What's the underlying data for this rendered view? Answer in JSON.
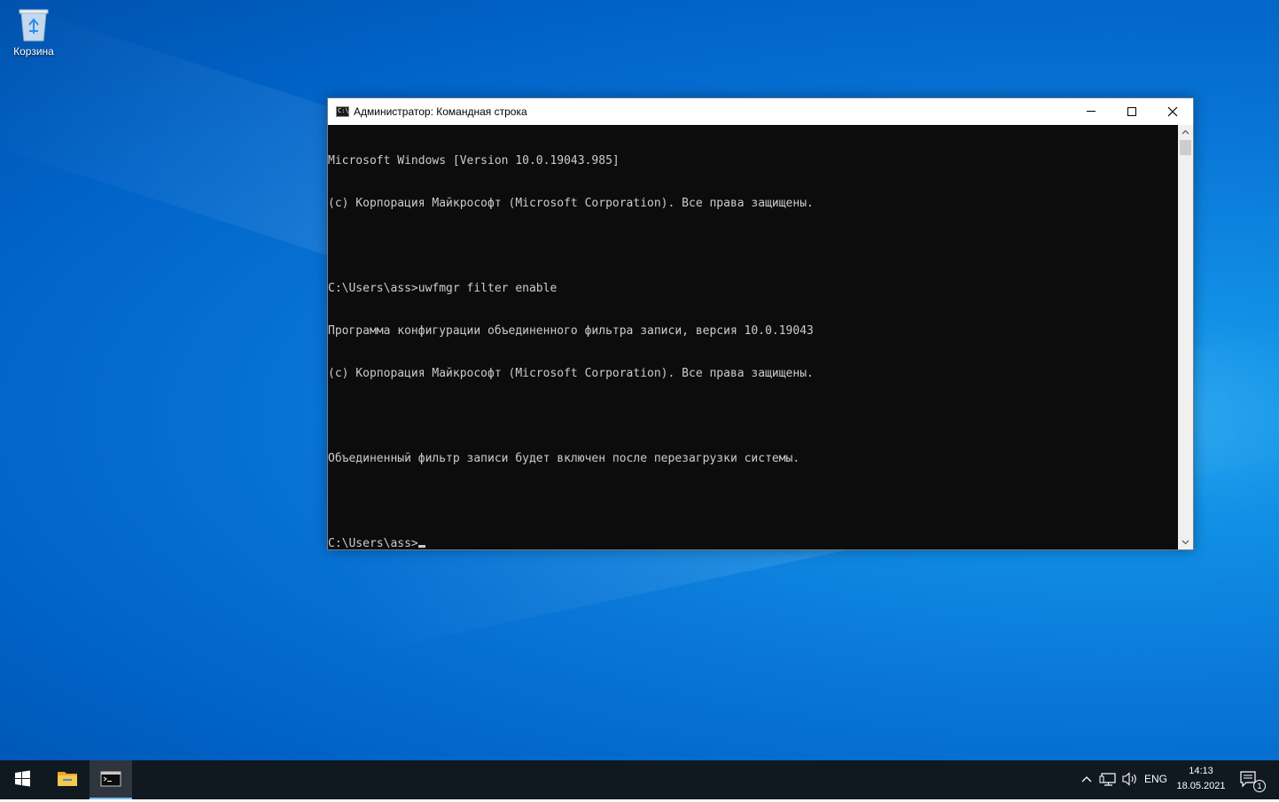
{
  "desktop": {
    "icons": [
      {
        "label": "Корзина",
        "icon": "recycle-bin-icon"
      }
    ]
  },
  "console_window": {
    "title": "Администратор: Командная строка",
    "icon": "cmd-icon",
    "icon_text": "C:\\_",
    "lines": [
      "Microsoft Windows [Version 10.0.19043.985]",
      "(c) Корпорация Майкрософт (Microsoft Corporation). Все права защищены.",
      "",
      "C:\\Users\\ass>uwfmgr filter enable",
      "Программа конфигурации объединенного фильтра записи, версия 10.0.19043",
      "(c) Корпорация Майкрософт (Microsoft Corporation). Все права защищены.",
      "",
      "Объединенный фильтр записи будет включен после перезагрузки системы.",
      ""
    ],
    "prompt": "C:\\Users\\ass>",
    "background": "#0c0c0c",
    "foreground": "#cccccc"
  },
  "taskbar": {
    "items": [
      {
        "name": "start",
        "icon": "windows-logo-icon"
      },
      {
        "name": "file-explorer",
        "icon": "folder-icon"
      },
      {
        "name": "command-prompt",
        "icon": "cmd-icon",
        "active": true
      }
    ],
    "tray": {
      "language": "ENG",
      "time": "14:13",
      "date": "18.05.2021",
      "notification_count": "1"
    },
    "accent": "#76b9ed"
  }
}
